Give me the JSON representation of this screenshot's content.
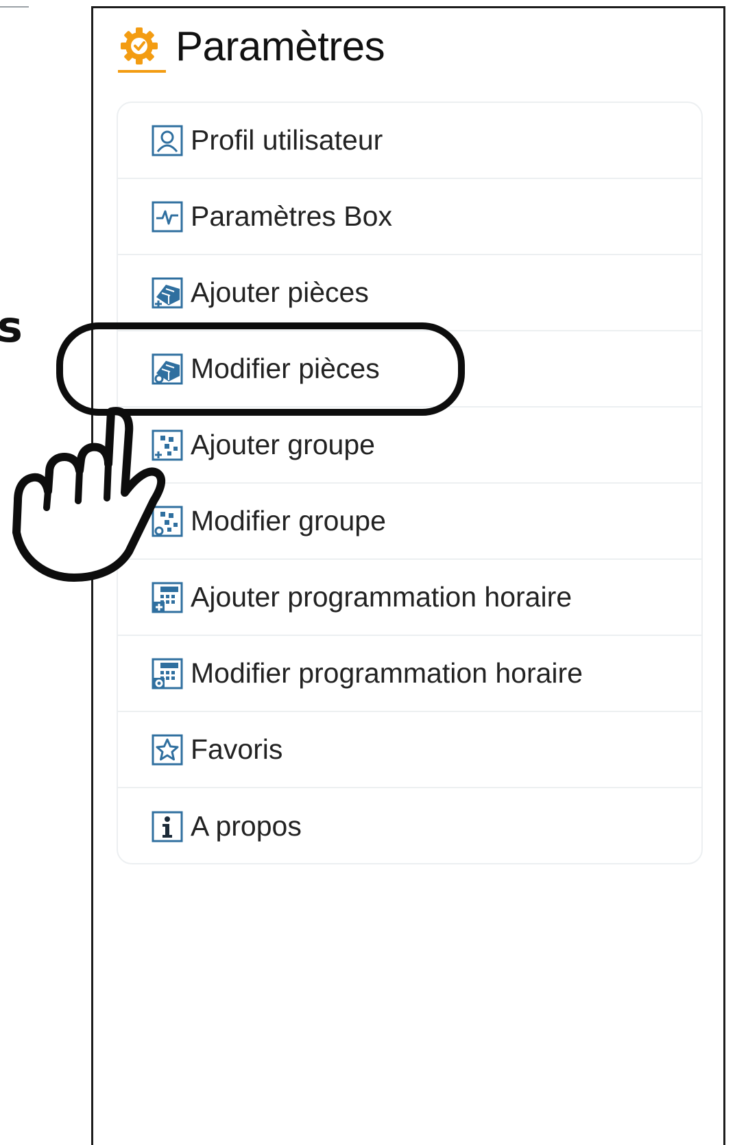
{
  "header": {
    "title": "Paramètres",
    "icon": "settings-gear-icon",
    "accent_color": "#f39c12"
  },
  "edge_text": "s",
  "menu": {
    "items": [
      {
        "label": "Profil utilisateur",
        "icon": "user-profile-icon"
      },
      {
        "label": "Paramètres Box",
        "icon": "box-pulse-icon"
      },
      {
        "label": "Ajouter pièces",
        "icon": "add-rooms-icon"
      },
      {
        "label": "Modifier pièces",
        "icon": "edit-rooms-icon",
        "highlighted": true
      },
      {
        "label": "Ajouter groupe",
        "icon": "add-group-icon"
      },
      {
        "label": "Modifier groupe",
        "icon": "edit-group-icon"
      },
      {
        "label": "Ajouter programmation horaire",
        "icon": "add-schedule-icon"
      },
      {
        "label": "Modifier programmation horaire",
        "icon": "edit-schedule-icon"
      },
      {
        "label": "Favoris",
        "icon": "star-icon"
      },
      {
        "label": "A propos",
        "icon": "info-icon"
      }
    ]
  },
  "annotation": {
    "pointer": "pointing-hand-icon",
    "colors": {
      "icon_blue": "#2f6f9f",
      "outline": "#0d0d0d"
    }
  }
}
